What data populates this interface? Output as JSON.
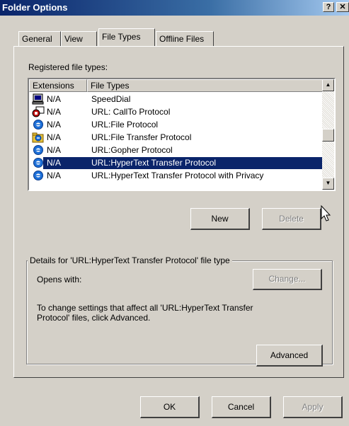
{
  "window": {
    "title": "Folder Options",
    "help_glyph": "?",
    "close_glyph": "✕"
  },
  "tabs": [
    {
      "label": "General"
    },
    {
      "label": "View"
    },
    {
      "label": "File Types"
    },
    {
      "label": "Offline Files"
    }
  ],
  "registered_label": "Registered file types:",
  "list": {
    "columns": [
      "Extensions",
      "File Types"
    ],
    "rows": [
      {
        "ext": "N/A",
        "type": "SpeedDial",
        "icon": "monitor-icon"
      },
      {
        "ext": "N/A",
        "type": "URL: CallTo Protocol",
        "icon": "callto-icon"
      },
      {
        "ext": "N/A",
        "type": "URL:File Protocol",
        "icon": "ie-icon"
      },
      {
        "ext": "N/A",
        "type": "URL:File Transfer Protocol",
        "icon": "ftp-folder-icon"
      },
      {
        "ext": "N/A",
        "type": "URL:Gopher Protocol",
        "icon": "ie-icon"
      },
      {
        "ext": "N/A",
        "type": "URL:HyperText Transfer Protocol",
        "icon": "ie-icon",
        "selected": true
      },
      {
        "ext": "N/A",
        "type": "URL:HyperText Transfer Protocol with Privacy",
        "icon": "ie-icon"
      }
    ],
    "scroll_up_glyph": "▲",
    "scroll_down_glyph": "▼"
  },
  "buttons": {
    "new": "New",
    "delete": "Delete",
    "change": "Change...",
    "advanced": "Advanced",
    "ok": "OK",
    "cancel": "Cancel",
    "apply": "Apply"
  },
  "details": {
    "group_title": "Details for 'URL:HyperText Transfer Protocol' file type",
    "opens_with": "Opens with:",
    "info_line1": "To change settings that affect all 'URL:HyperText Transfer",
    "info_line2": "Protocol' files, click Advanced."
  }
}
